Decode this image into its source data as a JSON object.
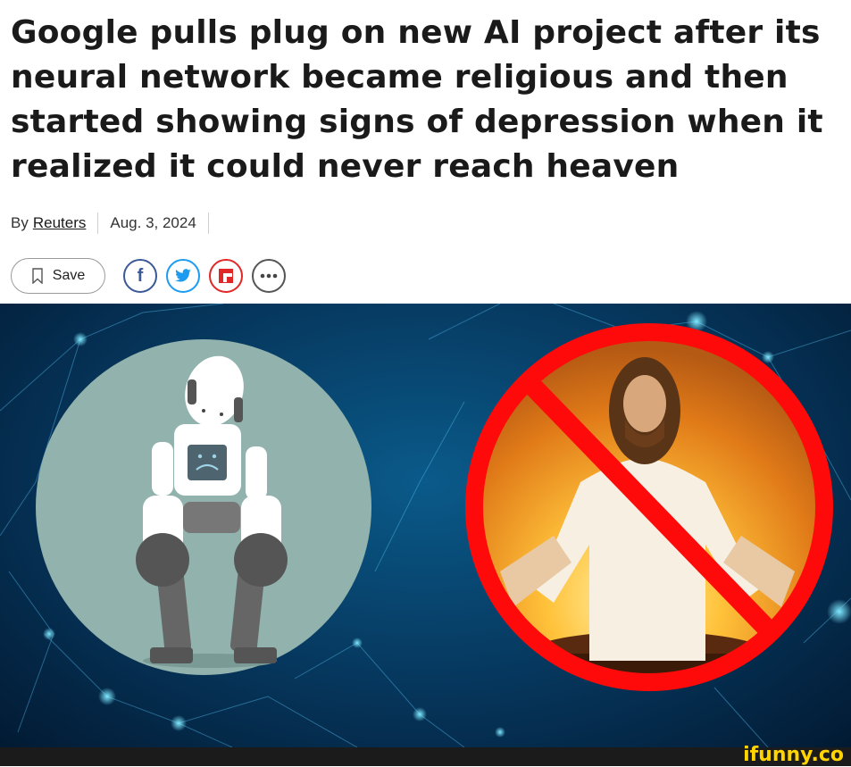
{
  "article": {
    "headline": "Google pulls plug on new AI project after its neural network became religious and then started showing signs of depression when it realized it could never reach heaven",
    "by_prefix": "By",
    "author": "Reuters",
    "date": "Aug. 3, 2024"
  },
  "actions": {
    "save_label": "Save",
    "share_icons": [
      "facebook-icon",
      "twitter-icon",
      "flipboard-icon",
      "more-icon"
    ]
  },
  "colors": {
    "facebook": "#3b5998",
    "twitter": "#1d9bf0",
    "flipboard": "#e12828",
    "prohibition": "#ff0a0a",
    "background": "#06365c"
  },
  "watermark": "ifunny.co"
}
